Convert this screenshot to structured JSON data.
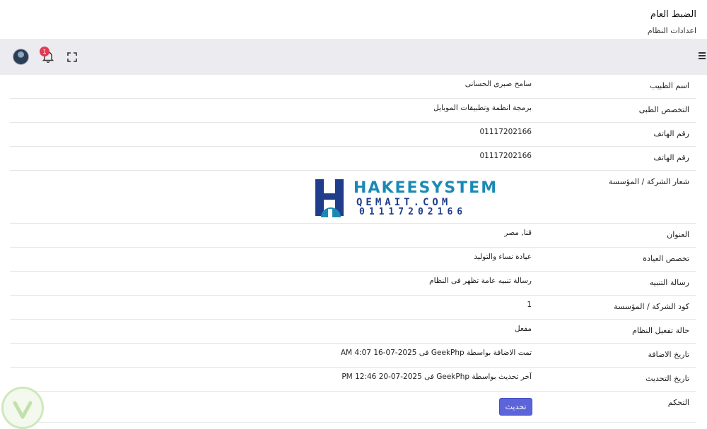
{
  "header": {
    "title": "الضبط العام",
    "subtitle": "اعدادات النظام"
  },
  "topbar": {
    "notification_count": "1"
  },
  "rows": [
    {
      "label": "اسم الطبيب",
      "value": "سامح صبرى الحسانى"
    },
    {
      "label": "التخصص الطبى",
      "value": "برمجة انظمة وتطبيقات الموبايل"
    },
    {
      "label": "رقم الهاتف",
      "value": "01117202166"
    },
    {
      "label": "رقم الهاتف",
      "value": "01117202166"
    },
    {
      "label": "شعار الشركة / المؤسسة"
    },
    {
      "label": "العنوان",
      "value": "قنا, مصر"
    },
    {
      "label": "تخصص العيادة",
      "value": "عيادة نساء والتوليد"
    },
    {
      "label": "رسالة التنبيه",
      "value": "رسالة تنبيه عامة تظهر فى النظام"
    },
    {
      "label": "كود الشركة / المؤسسة",
      "value": "1"
    },
    {
      "label": "حالة تفعيل النظام",
      "value": "مفعل"
    },
    {
      "label": "تاريخ الاضافة",
      "value": "تمت الاضافة بواسطة GeekPhp فى 2025-07-16 4:07 AM"
    },
    {
      "label": "تاريخ التحديث",
      "value": "آخر تحديث بواسطة GeekPhp فى 2025-07-20 12:46 PM"
    },
    {
      "label": "التحكم"
    }
  ],
  "logo": {
    "name": "HAKEESYSTEM",
    "domain": "QEMAIT.COM",
    "phone": "01117202166"
  },
  "actions": {
    "update_label": "تحديث"
  },
  "colors": {
    "topbar_bg": "#ebebf0",
    "button_primary": "#5b64d8",
    "badge": "#e53950",
    "logo_blue": "#1f3d8a",
    "logo_teal": "#1a8ab5"
  }
}
